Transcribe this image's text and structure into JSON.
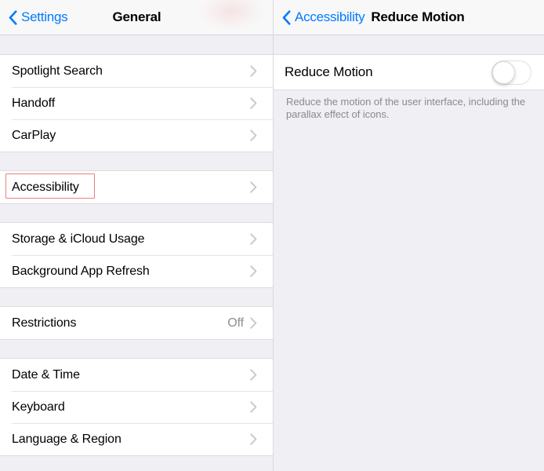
{
  "left": {
    "navbar": {
      "back_label": "Settings",
      "title": "General",
      "back_icon": "chevron-left-icon"
    },
    "groups": [
      {
        "rows": [
          {
            "label": "Spotlight Search",
            "value": "",
            "accessory": "chevron-right-icon"
          },
          {
            "label": "Handoff",
            "value": "",
            "accessory": "chevron-right-icon"
          },
          {
            "label": "CarPlay",
            "value": "",
            "accessory": "chevron-right-icon"
          }
        ]
      },
      {
        "rows": [
          {
            "label": "Accessibility",
            "value": "",
            "accessory": "chevron-right-icon",
            "highlighted": true
          }
        ]
      },
      {
        "rows": [
          {
            "label": "Storage & iCloud Usage",
            "value": "",
            "accessory": "chevron-right-icon"
          },
          {
            "label": "Background App Refresh",
            "value": "",
            "accessory": "chevron-right-icon"
          }
        ]
      },
      {
        "rows": [
          {
            "label": "Restrictions",
            "value": "Off",
            "accessory": "chevron-right-icon"
          }
        ]
      },
      {
        "rows": [
          {
            "label": "Date & Time",
            "value": "",
            "accessory": "chevron-right-icon"
          },
          {
            "label": "Keyboard",
            "value": "",
            "accessory": "chevron-right-icon"
          },
          {
            "label": "Language & Region",
            "value": "",
            "accessory": "chevron-right-icon"
          }
        ]
      }
    ]
  },
  "right": {
    "navbar": {
      "back_label": "Accessibility",
      "title": "Reduce Motion",
      "back_icon": "chevron-left-icon"
    },
    "setting": {
      "label": "Reduce Motion",
      "toggle_state": "off",
      "footer": "Reduce the motion of the user interface, including the parallax effect of icons."
    }
  },
  "colors": {
    "accent_blue": "#007aff",
    "group_background": "#efeff4",
    "cell_background": "#ffffff",
    "separator": "#c8c7cc",
    "secondary_text": "#8e8e93",
    "highlight_box": "#e8807f"
  }
}
